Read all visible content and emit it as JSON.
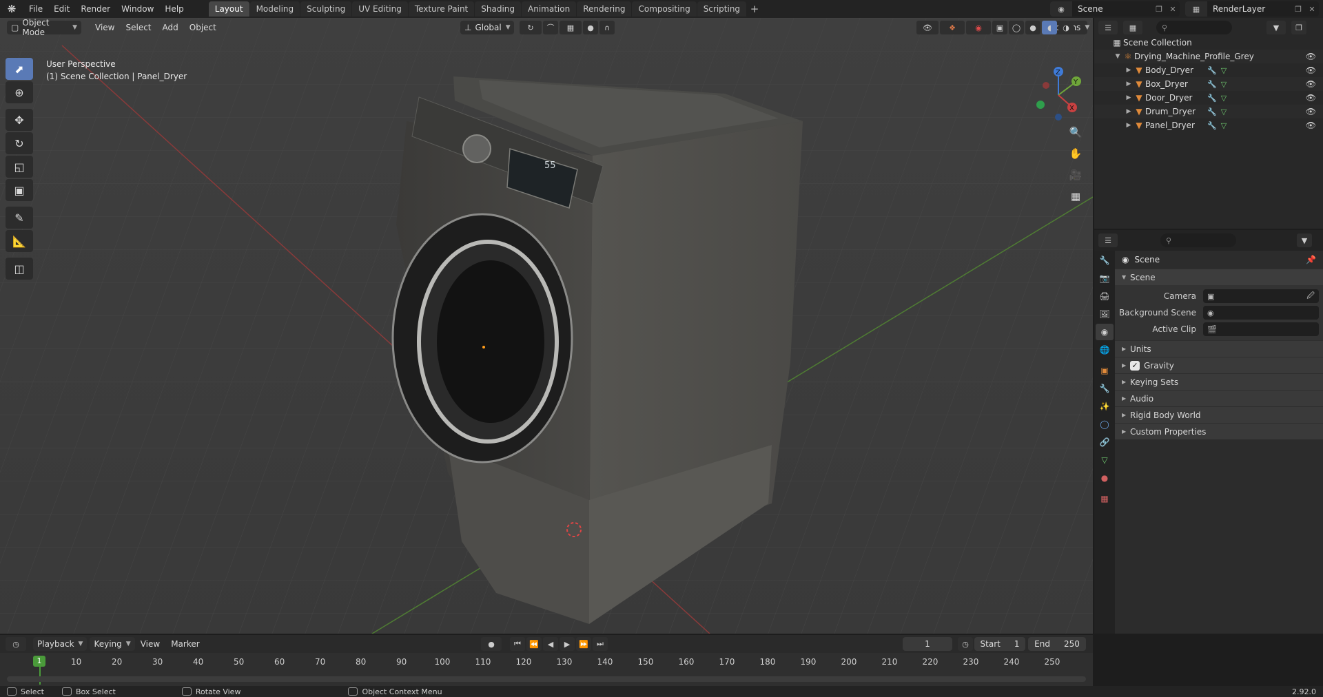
{
  "topbar": {
    "menus": [
      "File",
      "Edit",
      "Render",
      "Window",
      "Help"
    ],
    "workspaces": [
      "Layout",
      "Modeling",
      "Sculpting",
      "UV Editing",
      "Texture Paint",
      "Shading",
      "Animation",
      "Rendering",
      "Compositing",
      "Scripting"
    ],
    "active_workspace": "Layout",
    "add_label": "+",
    "scene_name": "Scene",
    "view_layer_name": "RenderLayer"
  },
  "viewport": {
    "mode": "Object Mode",
    "menus": [
      "View",
      "Select",
      "Add",
      "Object"
    ],
    "transform_orientation": "Global",
    "options_label": "Options",
    "perspective_label": "User Perspective",
    "collection_label": "(1) Scene Collection | Panel_Dryer",
    "gizmo_axes": {
      "x": "X",
      "y": "Y",
      "z": "Z"
    },
    "display_text": "55"
  },
  "outliner": {
    "root": "Scene Collection",
    "collection": "Drying_Machine_Profile_Grey",
    "objects": [
      "Body_Dryer",
      "Box_Dryer",
      "Door_Dryer",
      "Drum_Dryer",
      "Panel_Dryer"
    ]
  },
  "properties": {
    "context_name": "Scene",
    "panel_title": "Scene",
    "fields": [
      {
        "label": "Camera"
      },
      {
        "label": "Background Scene"
      },
      {
        "label": "Active Clip"
      }
    ],
    "sub_panels": [
      "Units",
      "Gravity",
      "Keying Sets",
      "Audio",
      "Rigid Body World",
      "Custom Properties"
    ],
    "gravity_checked": true
  },
  "timeline": {
    "menus": [
      "Playback",
      "Keying",
      "View",
      "Marker"
    ],
    "current_frame": "1",
    "start_label": "Start",
    "start_value": "1",
    "end_label": "End",
    "end_value": "250",
    "ruler_labels": [
      "10",
      "20",
      "30",
      "40",
      "50",
      "60",
      "70",
      "80",
      "90",
      "100",
      "110",
      "120",
      "130",
      "140",
      "150",
      "160",
      "170",
      "180",
      "190",
      "200",
      "210",
      "220",
      "230",
      "240",
      "250"
    ],
    "playhead_label": "1"
  },
  "statusbar": {
    "select": "Select",
    "box_select": "Box Select",
    "rotate_view": "Rotate View",
    "context_menu": "Object Context Menu",
    "version": "2.92.0"
  },
  "colors": {
    "accent": "#5a7ab6",
    "axis_x": "#c94141",
    "axis_y": "#6fa63a",
    "axis_z": "#3f7bd8",
    "playhead": "#4a9b3a",
    "object_icon": "#e08a3a"
  }
}
